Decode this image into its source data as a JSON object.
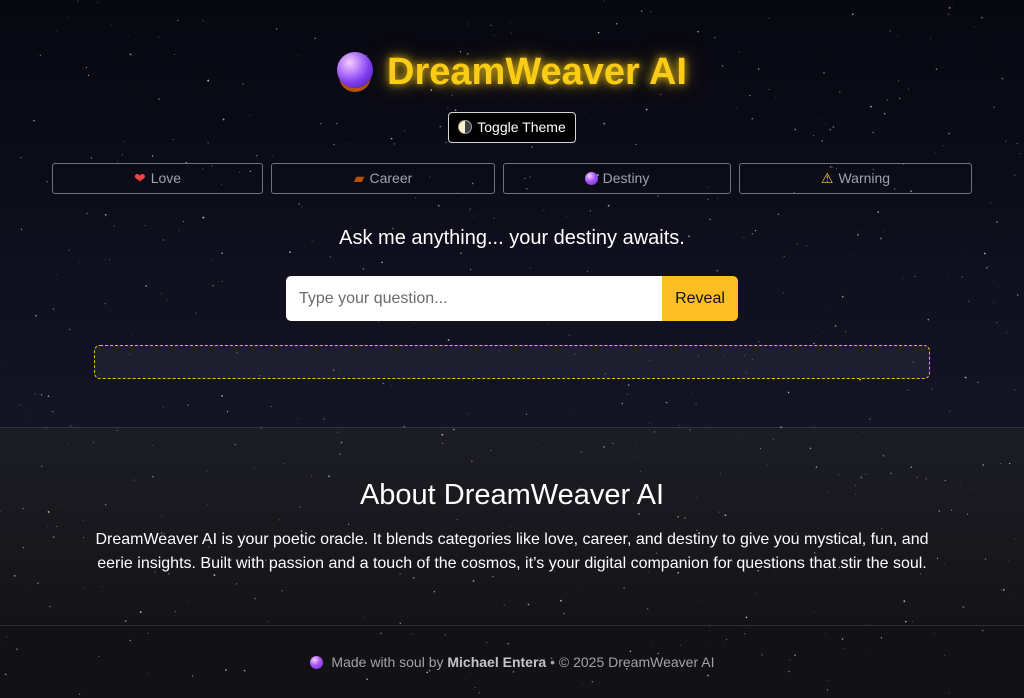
{
  "header": {
    "title": "DreamWeaver AI",
    "title_icon": "crystal-ball-icon",
    "accent_color": "#facc15"
  },
  "theme_toggle": {
    "icon": "half-moon-icon",
    "label": "Toggle Theme"
  },
  "categories": [
    {
      "icon": "heart-icon",
      "label": "Love"
    },
    {
      "icon": "briefcase-icon",
      "label": "Career"
    },
    {
      "icon": "crystal-ball-icon",
      "label": "Destiny"
    },
    {
      "icon": "warning-icon",
      "label": "Warning"
    }
  ],
  "prompt": {
    "subtitle": "Ask me anything... your destiny awaits.",
    "placeholder": "Type your question...",
    "value": "",
    "submit_label": "Reveal",
    "submit_color": "#fbbf24"
  },
  "answer": {
    "text": ""
  },
  "about": {
    "title": "About DreamWeaver AI",
    "body": "DreamWeaver AI is your poetic oracle. It blends categories like love, career, and destiny to give you mystical, fun, and eerie insights. Built with passion and a touch of the cosmos, it’s your digital companion for questions that stir the soul."
  },
  "footer": {
    "icon": "crystal-ball-icon",
    "prefix": "Made with soul by",
    "author": "Michael Entera",
    "suffix": "• © 2025 DreamWeaver AI"
  }
}
